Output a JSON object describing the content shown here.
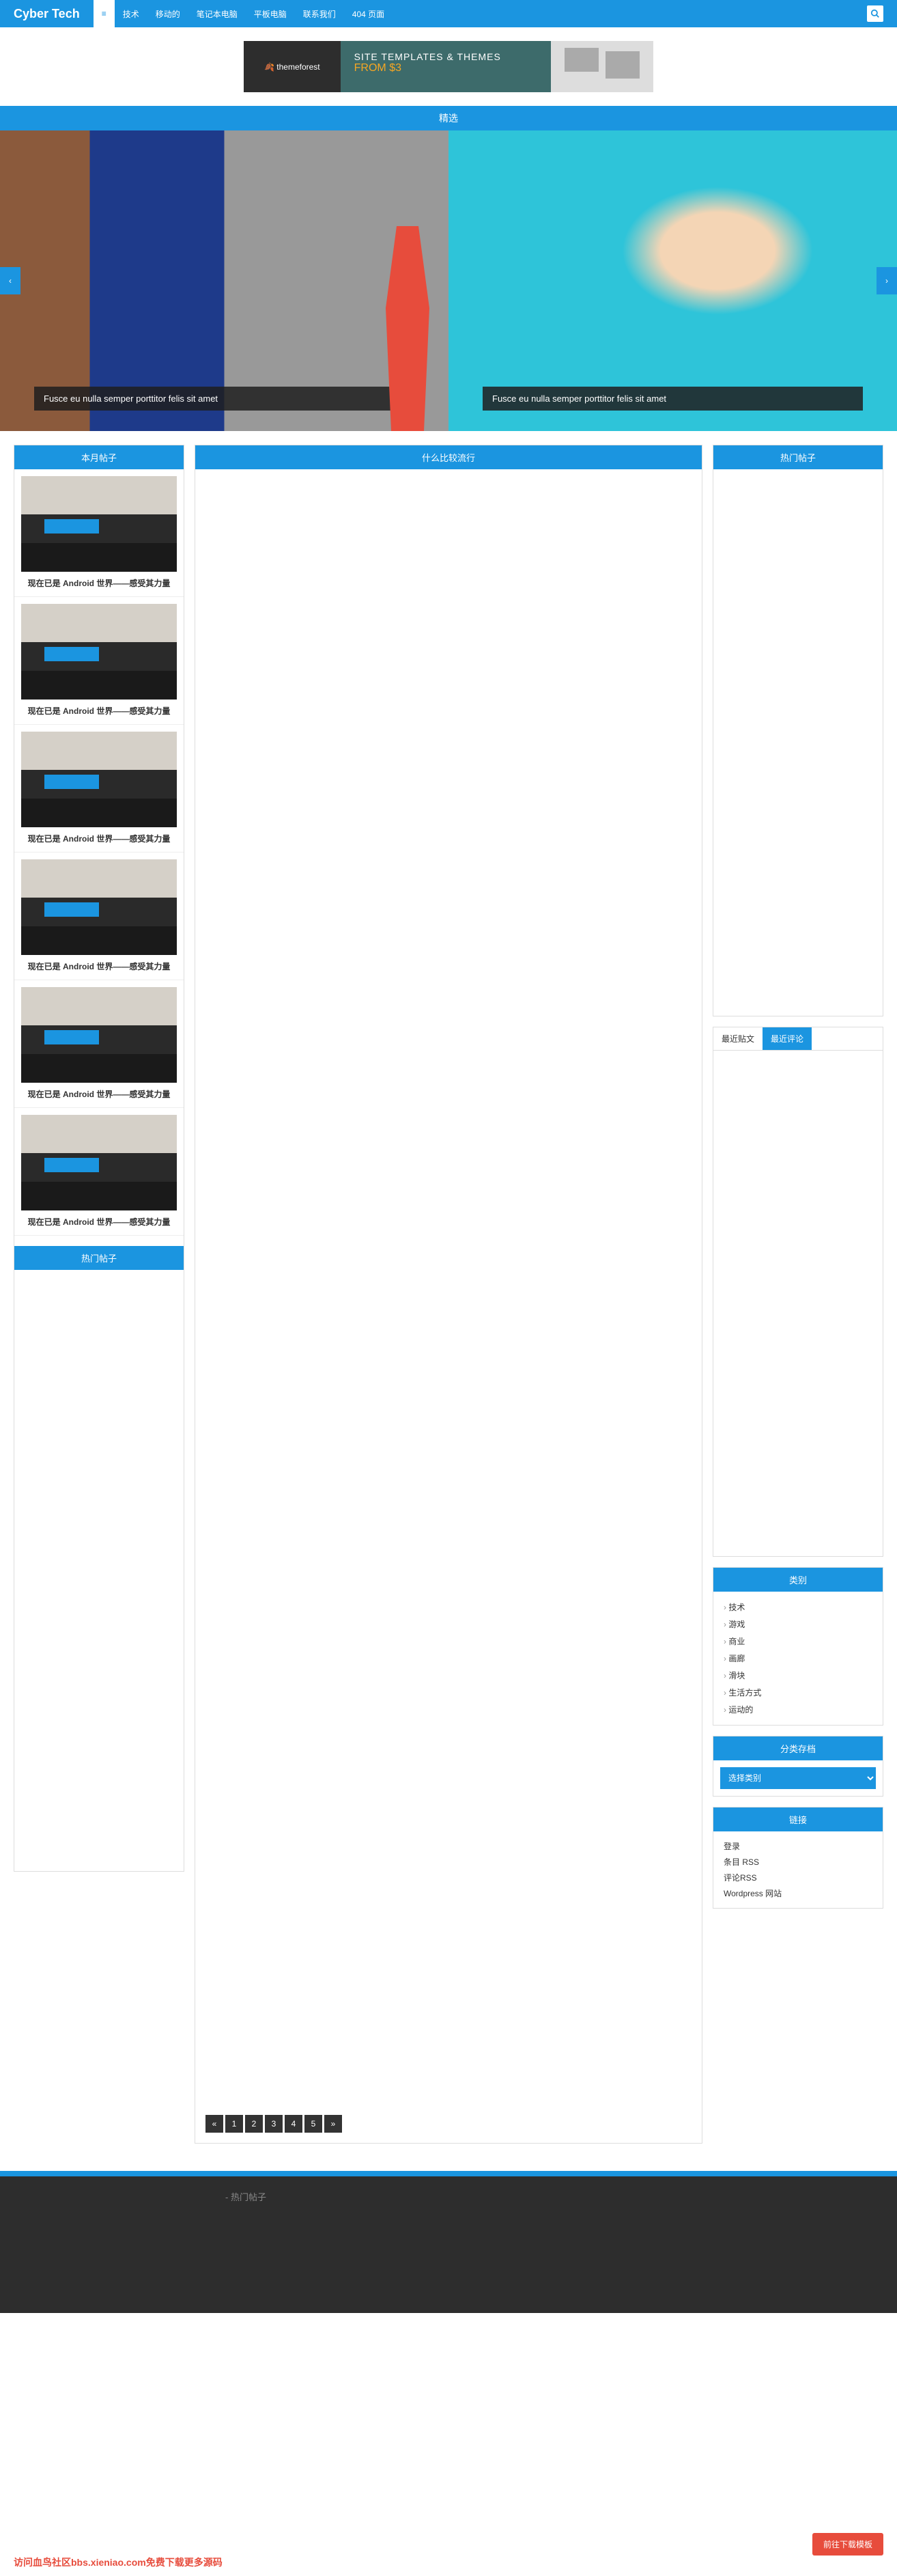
{
  "brand": "Cyber Tech",
  "nav": {
    "home_icon": "≡",
    "items": [
      "技术",
      "移动的",
      "笔记本电脑",
      "平板电脑",
      "联系我们",
      "404 页面"
    ]
  },
  "banner": {
    "logo": "🍂 themeforest",
    "line1": "SITE TEMPLATES & THEMES",
    "line2": "FROM $3"
  },
  "featured_label": "精选",
  "slides": [
    {
      "caption": "Fusce eu nulla semper porttitor felis sit amet"
    },
    {
      "caption": "Fusce eu nulla semper porttitor felis sit amet"
    }
  ],
  "left": {
    "monthly_title": "本月帖子",
    "hot_title": "热门帖子",
    "posts": [
      {
        "title": "现在已是 Android 世界——感受其力量"
      },
      {
        "title": "现在已是 Android 世界——感受其力量"
      },
      {
        "title": "现在已是 Android 世界——感受其力量"
      },
      {
        "title": "现在已是 Android 世界——感受其力量"
      },
      {
        "title": "现在已是 Android 世界——感受其力量"
      },
      {
        "title": "现在已是 Android 世界——感受其力量"
      }
    ]
  },
  "mid": {
    "title": "什么比较流行",
    "pages": [
      "«",
      "1",
      "2",
      "3",
      "4",
      "5",
      "»"
    ]
  },
  "right": {
    "hot_title": "热门帖子",
    "tabs": {
      "recent": "最近贴文",
      "comments": "最近评论"
    },
    "categories_title": "类别",
    "categories": [
      "技术",
      "游戏",
      "商业",
      "画廊",
      "滑块",
      "生活方式",
      "运动的"
    ],
    "archive_title": "分类存档",
    "archive_select": "选择类别",
    "links_title": "链接",
    "links": [
      "登录",
      "条目 RSS",
      "评论RSS",
      "Wordpress 网站"
    ]
  },
  "footer": {
    "hot_title": "- 热门帖子"
  },
  "download_btn": "前往下载模板",
  "watermark": "访问血鸟社区bbs.xieniao.com免费下载更多源码"
}
